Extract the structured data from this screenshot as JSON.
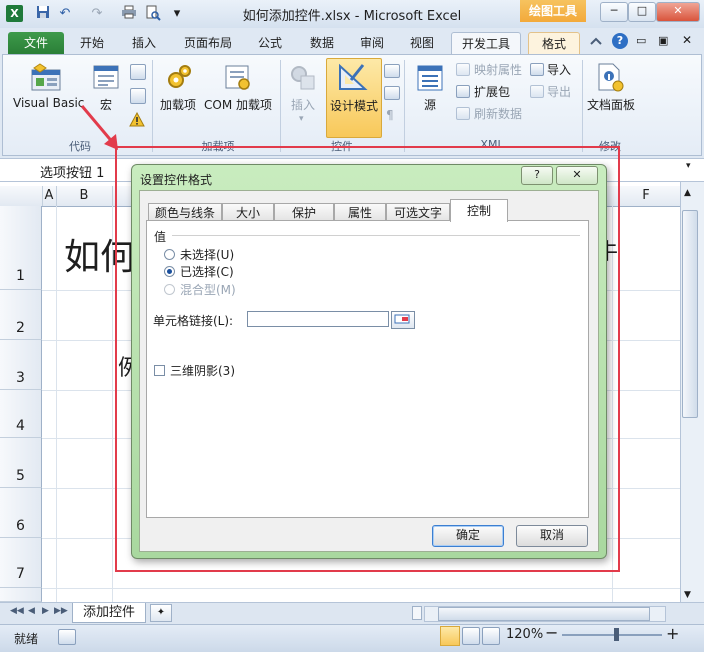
{
  "window": {
    "title": "如何添加控件.xlsx  -  Microsoft Excel",
    "context_group": "绘图工具",
    "logo_letter": "X",
    "minimize": "─",
    "restore": "□",
    "close": "✕"
  },
  "qat": {
    "undo_glyph": "↶",
    "redo_glyph": "↷",
    "dropdown_glyph": "▾"
  },
  "tabs": [
    "文件",
    "开始",
    "插入",
    "页面布局",
    "公式",
    "数据",
    "审阅",
    "视图",
    "开发工具",
    "格式"
  ],
  "ribbon": {
    "code": {
      "visual_basic": "Visual Basic",
      "macro": "宏",
      "group": "代码"
    },
    "addins": {
      "addins": "加载项",
      "com_addins": "COM 加载项",
      "group": "加载项"
    },
    "controls": {
      "insert": "插入",
      "design_mode": "设计模式",
      "group": "控件"
    },
    "xml": {
      "source": "源",
      "map_properties": "映射属性",
      "expansion_packs": "扩展包",
      "refresh_data": "刷新数据",
      "import": "导入",
      "export": "导出",
      "group": "XML"
    },
    "modify": {
      "document_panel": "文档面板",
      "group": "修改"
    }
  },
  "formula_bar": {
    "name_box": "选项按钮  1"
  },
  "sheet": {
    "columns": [
      "A",
      "B",
      "F"
    ],
    "rows": [
      "1",
      "2",
      "3",
      "4",
      "5",
      "6",
      "7"
    ],
    "title_fragment": "如何",
    "title_fragment_right": "牛",
    "row3_fragment": "例"
  },
  "sheet_tabs": {
    "active": "添加控件",
    "nav": [
      "◀◀",
      "◀",
      "▶",
      "▶▶"
    ]
  },
  "status": {
    "ready": "就绪",
    "zoom": "120%",
    "minus": "−",
    "plus": "+"
  },
  "dialog": {
    "title": "设置控件格式",
    "help": "?",
    "close": "✕",
    "tabs": [
      "颜色与线条",
      "大小",
      "保护",
      "属性",
      "可选文字",
      "控制"
    ],
    "value_label": "值",
    "radios": [
      {
        "label": "未选择(U)",
        "checked": false,
        "disabled": false
      },
      {
        "label": "已选择(C)",
        "checked": true,
        "disabled": false
      },
      {
        "label": "混合型(M)",
        "checked": false,
        "disabled": true
      }
    ],
    "cell_link_label": "单元格链接(L):",
    "cell_link_value": "",
    "shadow_label": "三维阴影(3)",
    "ok": "确定",
    "cancel": "取消"
  },
  "colors": {
    "accent_green": "#2a7f37",
    "highlight_red": "#e23b4b",
    "context_orange": "#f3a93a"
  }
}
